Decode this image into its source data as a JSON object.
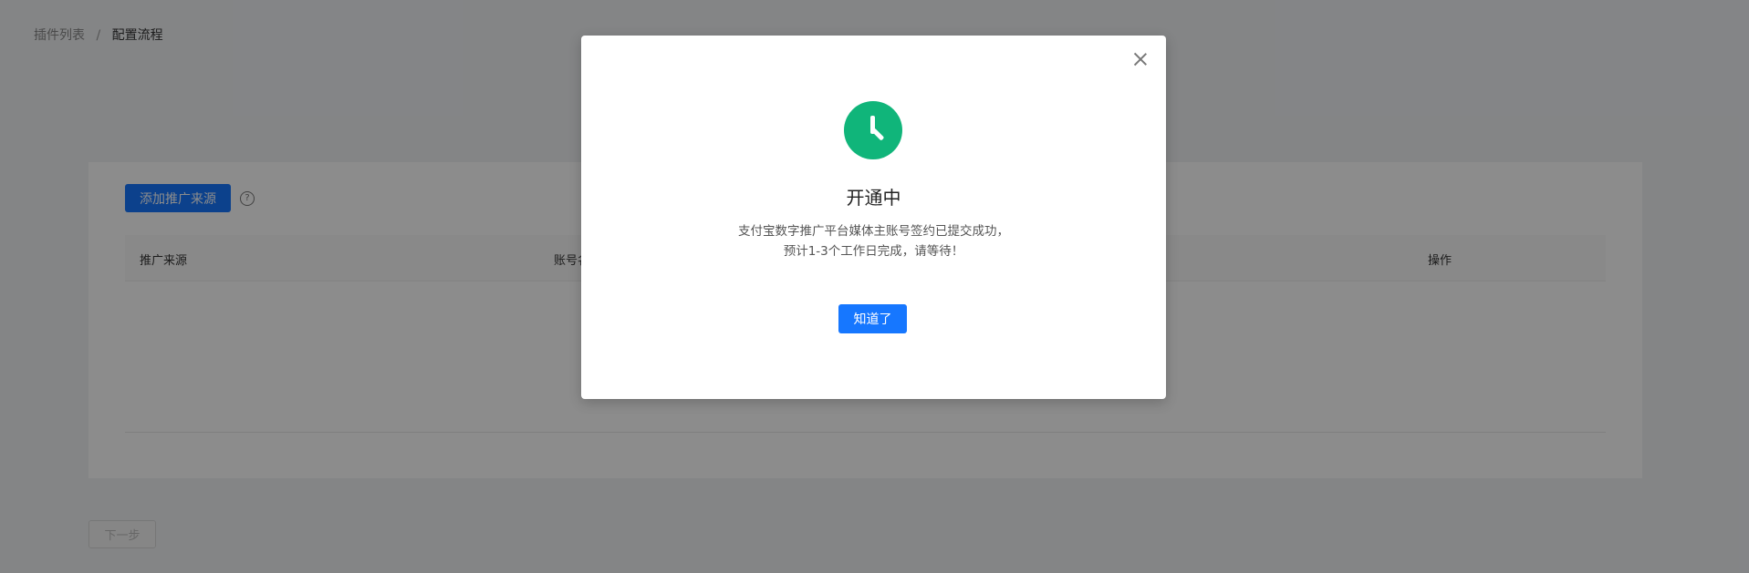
{
  "breadcrumb": {
    "items": [
      "插件列表",
      "配置流程"
    ],
    "separator": "/"
  },
  "card": {
    "add_button": "添加推广来源",
    "help_icon": "question-circle-icon",
    "table": {
      "columns": [
        "推广来源",
        "账号名称",
        "操作"
      ]
    }
  },
  "footer": {
    "next_button": "下一步"
  },
  "modal": {
    "icon": "clock-icon",
    "icon_color": "#10b57a",
    "title": "开通中",
    "desc_line1": "支付宝数字推广平台媒体主账号签约已提交成功，",
    "desc_line2": "预计1-3个工作日完成，请等待！",
    "ok_button": "知道了",
    "close_icon": "close-icon"
  },
  "colors": {
    "primary": "#1677ff",
    "success": "#10b57a"
  }
}
